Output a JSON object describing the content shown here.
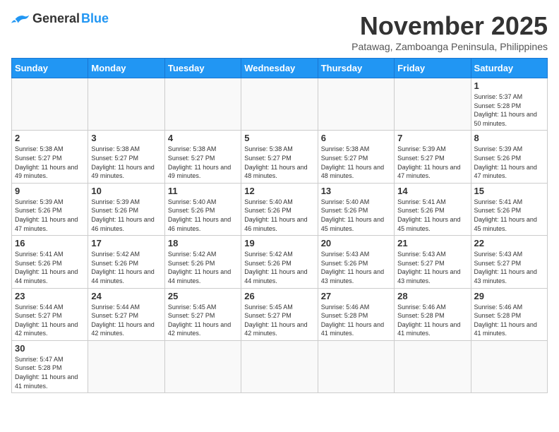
{
  "logo": {
    "general": "General",
    "blue": "Blue"
  },
  "title": "November 2025",
  "subtitle": "Patawag, Zamboanga Peninsula, Philippines",
  "days_header": [
    "Sunday",
    "Monday",
    "Tuesday",
    "Wednesday",
    "Thursday",
    "Friday",
    "Saturday"
  ],
  "weeks": [
    [
      {
        "day": "",
        "info": ""
      },
      {
        "day": "",
        "info": ""
      },
      {
        "day": "",
        "info": ""
      },
      {
        "day": "",
        "info": ""
      },
      {
        "day": "",
        "info": ""
      },
      {
        "day": "",
        "info": ""
      },
      {
        "day": "1",
        "info": "Sunrise: 5:37 AM\nSunset: 5:28 PM\nDaylight: 11 hours\nand 50 minutes."
      }
    ],
    [
      {
        "day": "2",
        "info": "Sunrise: 5:38 AM\nSunset: 5:27 PM\nDaylight: 11 hours\nand 49 minutes."
      },
      {
        "day": "3",
        "info": "Sunrise: 5:38 AM\nSunset: 5:27 PM\nDaylight: 11 hours\nand 49 minutes."
      },
      {
        "day": "4",
        "info": "Sunrise: 5:38 AM\nSunset: 5:27 PM\nDaylight: 11 hours\nand 49 minutes."
      },
      {
        "day": "5",
        "info": "Sunrise: 5:38 AM\nSunset: 5:27 PM\nDaylight: 11 hours\nand 48 minutes."
      },
      {
        "day": "6",
        "info": "Sunrise: 5:38 AM\nSunset: 5:27 PM\nDaylight: 11 hours\nand 48 minutes."
      },
      {
        "day": "7",
        "info": "Sunrise: 5:39 AM\nSunset: 5:27 PM\nDaylight: 11 hours\nand 47 minutes."
      },
      {
        "day": "8",
        "info": "Sunrise: 5:39 AM\nSunset: 5:26 PM\nDaylight: 11 hours\nand 47 minutes."
      }
    ],
    [
      {
        "day": "9",
        "info": "Sunrise: 5:39 AM\nSunset: 5:26 PM\nDaylight: 11 hours\nand 47 minutes."
      },
      {
        "day": "10",
        "info": "Sunrise: 5:39 AM\nSunset: 5:26 PM\nDaylight: 11 hours\nand 46 minutes."
      },
      {
        "day": "11",
        "info": "Sunrise: 5:40 AM\nSunset: 5:26 PM\nDaylight: 11 hours\nand 46 minutes."
      },
      {
        "day": "12",
        "info": "Sunrise: 5:40 AM\nSunset: 5:26 PM\nDaylight: 11 hours\nand 46 minutes."
      },
      {
        "day": "13",
        "info": "Sunrise: 5:40 AM\nSunset: 5:26 PM\nDaylight: 11 hours\nand 45 minutes."
      },
      {
        "day": "14",
        "info": "Sunrise: 5:41 AM\nSunset: 5:26 PM\nDaylight: 11 hours\nand 45 minutes."
      },
      {
        "day": "15",
        "info": "Sunrise: 5:41 AM\nSunset: 5:26 PM\nDaylight: 11 hours\nand 45 minutes."
      }
    ],
    [
      {
        "day": "16",
        "info": "Sunrise: 5:41 AM\nSunset: 5:26 PM\nDaylight: 11 hours\nand 44 minutes."
      },
      {
        "day": "17",
        "info": "Sunrise: 5:42 AM\nSunset: 5:26 PM\nDaylight: 11 hours\nand 44 minutes."
      },
      {
        "day": "18",
        "info": "Sunrise: 5:42 AM\nSunset: 5:26 PM\nDaylight: 11 hours\nand 44 minutes."
      },
      {
        "day": "19",
        "info": "Sunrise: 5:42 AM\nSunset: 5:26 PM\nDaylight: 11 hours\nand 44 minutes."
      },
      {
        "day": "20",
        "info": "Sunrise: 5:43 AM\nSunset: 5:26 PM\nDaylight: 11 hours\nand 43 minutes."
      },
      {
        "day": "21",
        "info": "Sunrise: 5:43 AM\nSunset: 5:27 PM\nDaylight: 11 hours\nand 43 minutes."
      },
      {
        "day": "22",
        "info": "Sunrise: 5:43 AM\nSunset: 5:27 PM\nDaylight: 11 hours\nand 43 minutes."
      }
    ],
    [
      {
        "day": "23",
        "info": "Sunrise: 5:44 AM\nSunset: 5:27 PM\nDaylight: 11 hours\nand 42 minutes."
      },
      {
        "day": "24",
        "info": "Sunrise: 5:44 AM\nSunset: 5:27 PM\nDaylight: 11 hours\nand 42 minutes."
      },
      {
        "day": "25",
        "info": "Sunrise: 5:45 AM\nSunset: 5:27 PM\nDaylight: 11 hours\nand 42 minutes."
      },
      {
        "day": "26",
        "info": "Sunrise: 5:45 AM\nSunset: 5:27 PM\nDaylight: 11 hours\nand 42 minutes."
      },
      {
        "day": "27",
        "info": "Sunrise: 5:46 AM\nSunset: 5:28 PM\nDaylight: 11 hours\nand 41 minutes."
      },
      {
        "day": "28",
        "info": "Sunrise: 5:46 AM\nSunset: 5:28 PM\nDaylight: 11 hours\nand 41 minutes."
      },
      {
        "day": "29",
        "info": "Sunrise: 5:46 AM\nSunset: 5:28 PM\nDaylight: 11 hours\nand 41 minutes."
      }
    ],
    [
      {
        "day": "30",
        "info": "Sunrise: 5:47 AM\nSunset: 5:28 PM\nDaylight: 11 hours\nand 41 minutes."
      },
      {
        "day": "",
        "info": ""
      },
      {
        "day": "",
        "info": ""
      },
      {
        "day": "",
        "info": ""
      },
      {
        "day": "",
        "info": ""
      },
      {
        "day": "",
        "info": ""
      },
      {
        "day": "",
        "info": ""
      }
    ]
  ]
}
